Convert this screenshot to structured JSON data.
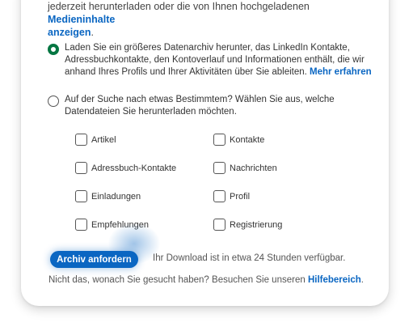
{
  "intro": {
    "text": "jederzeit herunterladen oder die von Ihnen hochgeladenen ",
    "link_line1": "Medieninhalte",
    "link_line2": "anzeigen",
    "suffix": "."
  },
  "option_full": {
    "text": "Laden Sie ein größeres Datenarchiv herunter, das LinkedIn Kontakte, Adressbuchkontakte, den Kontoverlauf und Informationen enthält, die wir anhand Ihres Profils und Ihrer Aktivitäten über Sie ableiten. ",
    "link": "Mehr erfahren",
    "selected": true
  },
  "option_custom": {
    "text": "Auf der Suche nach etwas Bestimmtem? Wählen Sie aus, welche Datendateien Sie herunterladen möchten.",
    "selected": false
  },
  "checkboxes": [
    "Artikel",
    "Kontakte",
    "Adressbuch-Kontakte",
    "Nachrichten",
    "Einladungen",
    "Profil",
    "Empfehlungen",
    "Registrierung"
  ],
  "action": {
    "button_label": "Archiv anfordern",
    "note": "Ihr Download ist in etwa 24 Stunden verfügbar."
  },
  "help": {
    "text": "Nicht das, wonach Sie gesucht haben? Besuchen Sie unseren ",
    "link": "Hilfebereich",
    "suffix": "."
  },
  "colors": {
    "accent": "#0a66c2",
    "selected_radio": "#057642"
  }
}
